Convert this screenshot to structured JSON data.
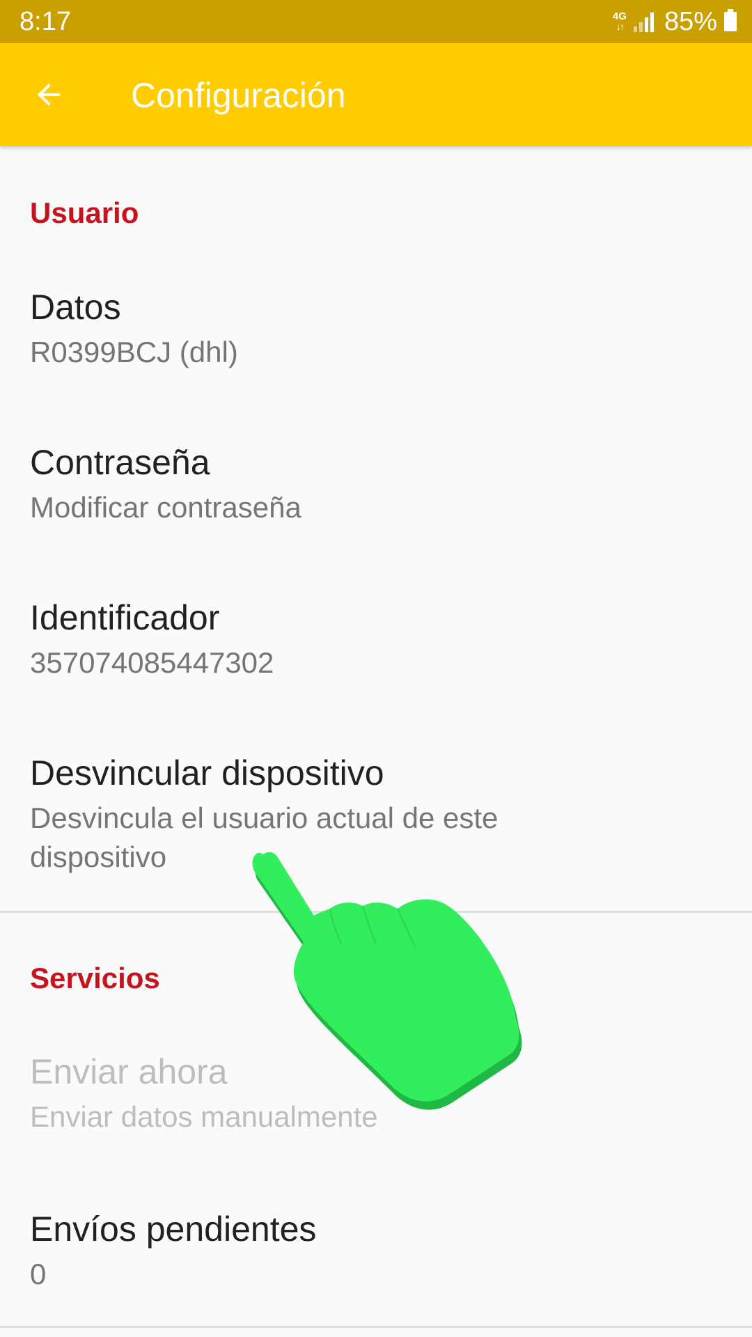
{
  "status_bar": {
    "time": "8:17",
    "network_type": "4G",
    "battery_percent": "85%"
  },
  "app_bar": {
    "title": "Configuración",
    "back_icon": "arrow-back-icon"
  },
  "sections": {
    "usuario": {
      "header": "Usuario",
      "items": [
        {
          "title": "Datos",
          "summary": "R0399BCJ (dhl)"
        },
        {
          "title": "Contraseña",
          "summary": "Modificar contraseña"
        },
        {
          "title": "Identificador",
          "summary": "357074085447302"
        },
        {
          "title": "Desvincular dispositivo",
          "summary": "Desvincula el usuario actual de este dispositivo"
        }
      ]
    },
    "servicios": {
      "header": "Servicios",
      "items": [
        {
          "title": "Enviar ahora",
          "summary": "Enviar datos manualmente",
          "enabled": false
        },
        {
          "title": "Envíos pendientes",
          "summary": "0"
        }
      ]
    }
  },
  "colors": {
    "status_bar": "#c9a000",
    "app_bar": "#ffcc00",
    "section_header": "#c6131d",
    "hand_overlay": "#33ee5c"
  },
  "overlay": {
    "icon": "hand-pointer-icon"
  }
}
